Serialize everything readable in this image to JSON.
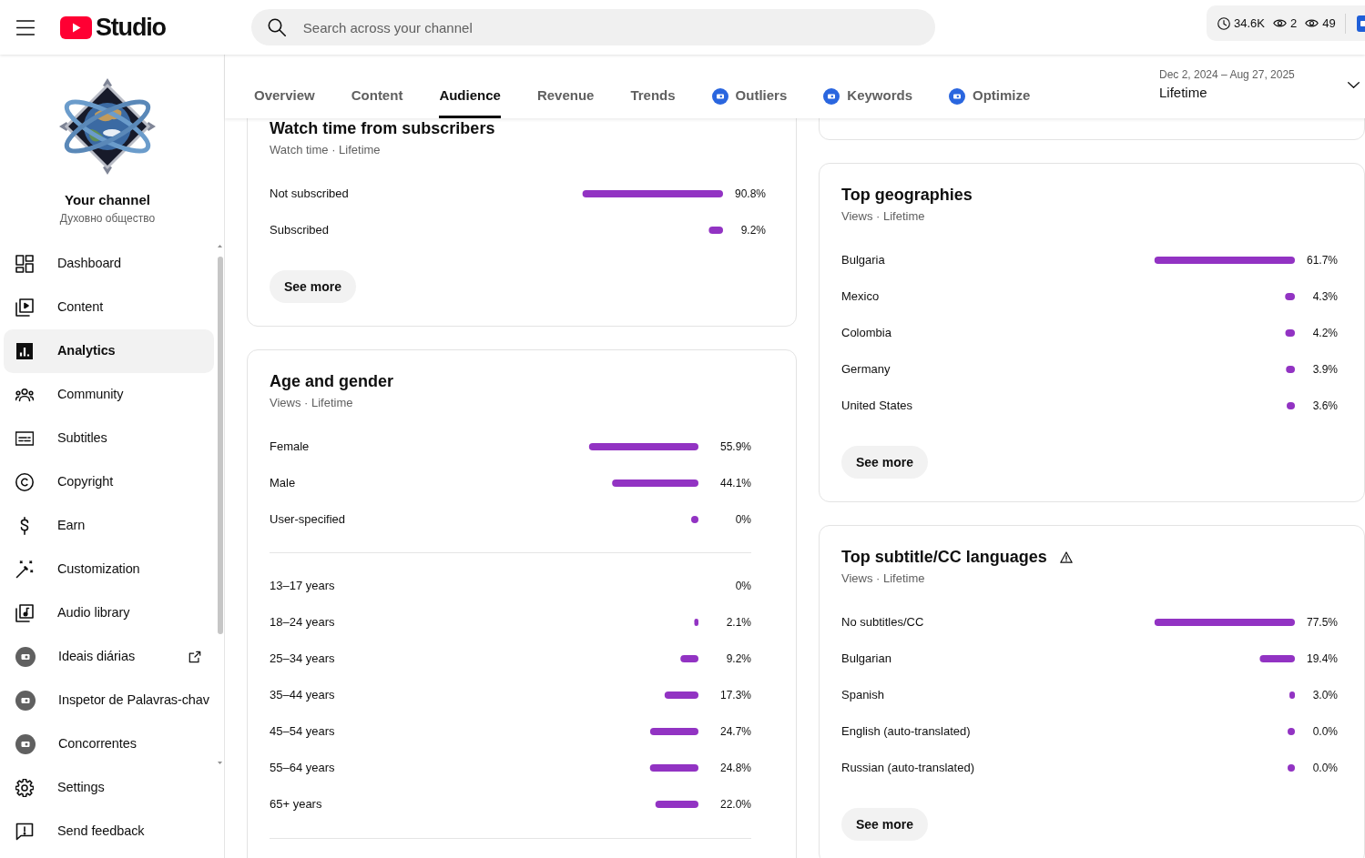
{
  "header": {
    "logo": "Studio",
    "search": {
      "placeholder": "Search across your channel"
    },
    "stats": [
      {
        "kind": "clock",
        "value": "34.6K"
      },
      {
        "kind": "eye",
        "value": "2"
      },
      {
        "kind": "eye",
        "value": "49"
      }
    ]
  },
  "sidebar": {
    "channel": {
      "title": "Your channel",
      "name": "Духовно общество"
    },
    "items": [
      {
        "label": "Dashboard",
        "selected": false,
        "external_link": false
      },
      {
        "label": "Content",
        "selected": false,
        "external_link": false
      },
      {
        "label": "Analytics",
        "selected": true,
        "external_link": false
      },
      {
        "label": "Community",
        "selected": false,
        "external_link": false
      },
      {
        "label": "Subtitles",
        "selected": false,
        "external_link": false
      },
      {
        "label": "Copyright",
        "selected": false,
        "external_link": false
      },
      {
        "label": "Earn",
        "selected": false,
        "external_link": false
      },
      {
        "label": "Customization",
        "selected": false,
        "external_link": false
      },
      {
        "label": "Audio library",
        "selected": false,
        "external_link": false
      },
      {
        "label": "Ideais diárias",
        "selected": false,
        "external_link": true
      },
      {
        "label": "Inspetor de Palavras-chav",
        "selected": false,
        "external_link": false
      },
      {
        "label": "Concorrentes",
        "selected": false,
        "external_link": false
      }
    ],
    "footer_items": [
      {
        "label": "Settings",
        "selected": false
      },
      {
        "label": "Send feedback",
        "selected": false
      }
    ]
  },
  "tabs": [
    {
      "label": "Overview",
      "kind": "plain",
      "selected": false
    },
    {
      "label": "Content",
      "kind": "plain",
      "selected": false
    },
    {
      "label": "Audience",
      "kind": "plain",
      "selected": true
    },
    {
      "label": "Revenue",
      "kind": "plain",
      "selected": false
    },
    {
      "label": "Trends",
      "kind": "plain",
      "selected": false
    },
    {
      "label": "Outliers",
      "kind": "extension",
      "selected": false
    },
    {
      "label": "Keywords",
      "kind": "extension",
      "selected": false
    },
    {
      "label": "Optimize",
      "kind": "extension",
      "selected": false
    }
  ],
  "date_range": {
    "range": "Dec 2, 2024 – Aug 27, 2025",
    "period": "Lifetime"
  },
  "cards": {
    "left": [
      {
        "title": "Watch time from subscribers",
        "subtitle": "Watch time · Lifetime",
        "warning": false,
        "charts": [
          {
            "chart_data": {
              "type": "bar",
              "orientation": "horizontal",
              "categories": [
                "Not subscribed",
                "Subscribed"
              ],
              "values": [
                90.8,
                9.2
              ],
              "value_labels": [
                "90.8%",
                "9.2%"
              ]
            }
          }
        ],
        "button": "See more"
      },
      {
        "title": "Age and gender",
        "subtitle": "Views · Lifetime",
        "warning": false,
        "charts": [
          {
            "chart_data": {
              "type": "bar",
              "orientation": "horizontal",
              "categories": [
                "Female",
                "Male",
                "User-specified"
              ],
              "values": [
                55.9,
                44.1,
                0.04
              ],
              "value_labels": [
                "55.9%",
                "44.1%",
                "0%"
              ]
            }
          },
          {
            "chart_data": {
              "type": "bar",
              "orientation": "horizontal",
              "categories": [
                "13–17 years",
                "18–24 years",
                "25–34 years",
                "35–44 years",
                "45–54 years",
                "55–64 years",
                "65+ years"
              ],
              "values": [
                0,
                2.1,
                9.2,
                17.3,
                24.7,
                24.8,
                22.0
              ],
              "value_labels": [
                "0%",
                "2.1%",
                "9.2%",
                "17.3%",
                "24.7%",
                "24.8%",
                "22.0%"
              ]
            }
          }
        ]
      }
    ],
    "right": [
      {
        "title": "Top geographies",
        "subtitle": "Views · Lifetime",
        "warning": false,
        "charts": [
          {
            "chart_data": {
              "type": "bar",
              "orientation": "horizontal",
              "categories": [
                "Bulgaria",
                "Mexico",
                "Colombia",
                "Germany",
                "United States"
              ],
              "values": [
                61.7,
                4.3,
                4.2,
                3.9,
                3.6
              ],
              "value_labels": [
                "61.7%",
                "4.3%",
                "4.2%",
                "3.9%",
                "3.6%"
              ]
            }
          }
        ],
        "button": "See more"
      },
      {
        "title": "Top subtitle/CC languages",
        "subtitle": "Views · Lifetime",
        "warning": true,
        "charts": [
          {
            "chart_data": {
              "type": "bar",
              "orientation": "horizontal",
              "categories": [
                "No subtitles/CC",
                "Bulgarian",
                "Spanish",
                "English (auto-translated)",
                "Russian (auto-translated)"
              ],
              "values": [
                77.5,
                19.4,
                3.0,
                0.02,
                0.02
              ],
              "value_labels": [
                "77.5%",
                "19.4%",
                "3.0%",
                "0.0%",
                "0.0%"
              ]
            }
          }
        ],
        "button": "See more"
      }
    ]
  }
}
